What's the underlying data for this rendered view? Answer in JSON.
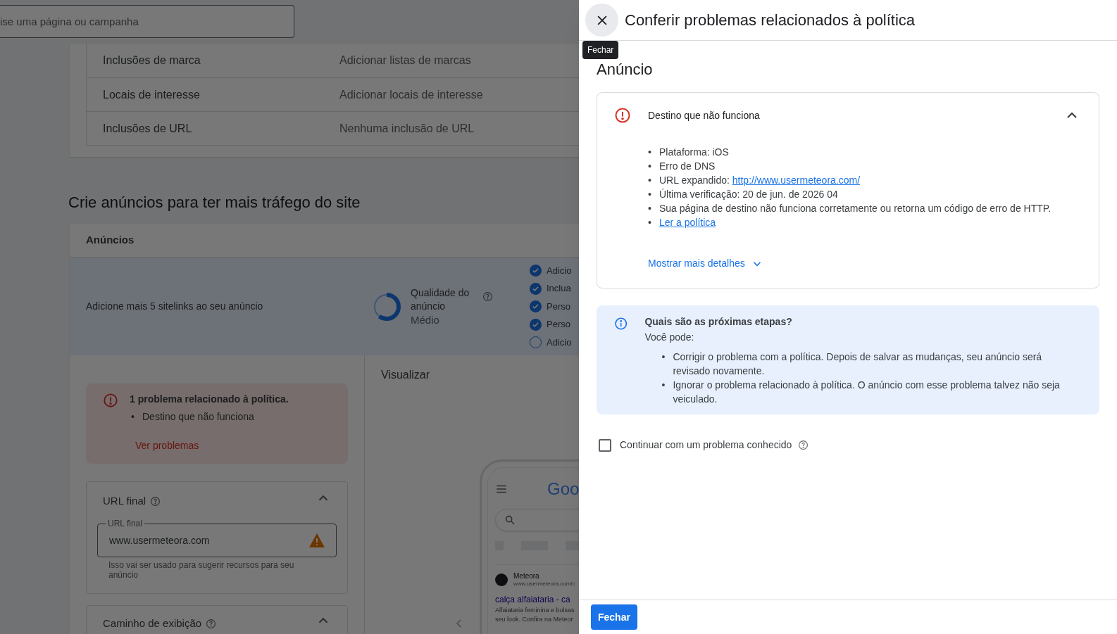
{
  "bullet": "•",
  "search": {
    "placeholder": "ise uma página ou campanha"
  },
  "inclusions": [
    {
      "label": "Inclusões de marca",
      "value": "Adicionar listas de marcas"
    },
    {
      "label": "Locais de interesse",
      "value": "Adicionar locais de interesse"
    },
    {
      "label": "Inclusões de URL",
      "value": "Nenhuma inclusão de URL"
    }
  ],
  "section_heading": "Crie anúncios para ter mais tráfego do site",
  "ads_card": {
    "title": "Anúncios",
    "suggestion": "Adicione mais 5 sitelinks ao seu anúncio",
    "quality": {
      "label": "Qualidade do anúncio",
      "rating": "Médio",
      "level": 0.6
    },
    "checklist": [
      {
        "label": "Adicio",
        "checked": true
      },
      {
        "label": "Inclua",
        "checked": true
      },
      {
        "label": "Perso",
        "checked": true
      },
      {
        "label": "Perso",
        "checked": true
      },
      {
        "label": "Adicio",
        "checked": false
      }
    ]
  },
  "policy_alert": {
    "title": "1 problema relacionado à política.",
    "items": [
      "Destino que não funciona"
    ],
    "link": "Ver problemas"
  },
  "final_url": {
    "title": "URL final",
    "expanded": true,
    "field_label": "URL final",
    "value": "www.usermeteora.com",
    "warning": true,
    "hint": "Isso vai ser usado para sugerir recursos para seu anúncio"
  },
  "display_path": {
    "title": "Caminho de exibição",
    "expanded": true
  },
  "preview": {
    "title": "Visualizar",
    "logo": "Goo",
    "advertiser": "Meteora",
    "display_url": "www.usermeteora.com/c",
    "headline": "calça alfaiataria - ca",
    "description_lines": [
      "Alfaiataria feminina e bolsas",
      "seu look. Confira na Meteor"
    ]
  },
  "drawer": {
    "title": "Conferir problemas relacionados à política",
    "close_tooltip": "Fechar",
    "section": "Anúncio",
    "issue": {
      "title": "Destino que não funciona",
      "expanded": true,
      "details": [
        {
          "kind": "text",
          "text": "Plataforma: iOS"
        },
        {
          "kind": "text",
          "text": "Erro de DNS"
        },
        {
          "kind": "text_link",
          "text": "URL expandido:",
          "link": "http://www.usermeteora.com/"
        },
        {
          "kind": "text",
          "text": "Última verificação: 20 de jun. de 2026 04"
        },
        {
          "kind": "text",
          "text": "Sua página de destino não funciona corretamente ou retorna um código de erro de HTTP."
        },
        {
          "kind": "link",
          "link": "Ler a política"
        }
      ],
      "more": "Mostrar mais detalhes"
    },
    "next_steps": {
      "title": "Quais são as próximas etapas?",
      "intro": "Você pode:",
      "items": [
        "Corrigir o problema com a política. Depois de salvar as mudanças, seu anúncio será revisado novamente.",
        "Ignorar o problema relacionado à política. O anúncio com esse problema talvez não seja veiculado."
      ]
    },
    "continue": {
      "label": "Continuar com um problema conhecido",
      "checked": false
    },
    "footer_button": "Fechar"
  }
}
